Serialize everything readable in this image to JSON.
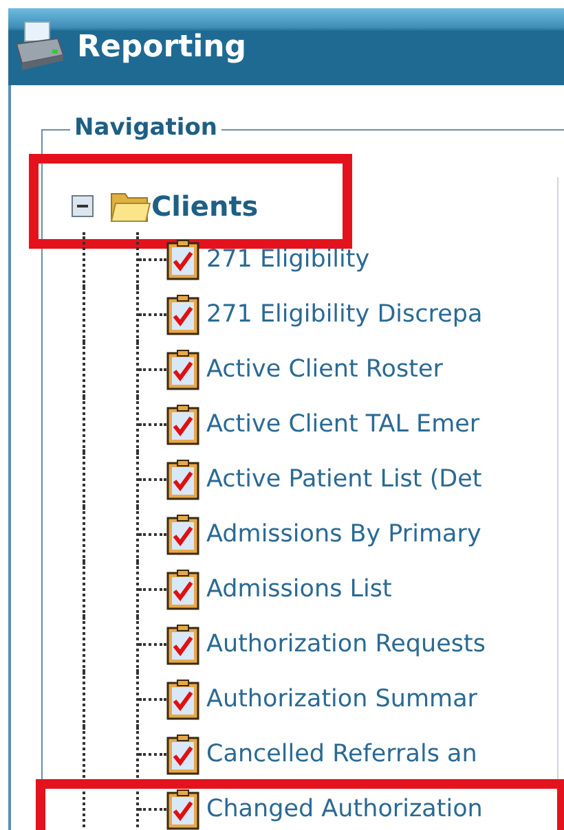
{
  "header": {
    "title": "Reporting"
  },
  "navigation": {
    "legend": "Navigation",
    "tree": {
      "label": "Clients",
      "expanded": true,
      "highlighted": true,
      "children": [
        {
          "label": "271 Eligibility",
          "highlighted": false
        },
        {
          "label": "271 Eligibility Discrepa",
          "highlighted": false
        },
        {
          "label": "Active Client Roster",
          "highlighted": false
        },
        {
          "label": "Active Client TAL Emer",
          "highlighted": false
        },
        {
          "label": "Active Patient List (Det",
          "highlighted": false
        },
        {
          "label": "Admissions By Primary",
          "highlighted": false
        },
        {
          "label": "Admissions List",
          "highlighted": false
        },
        {
          "label": "Authorization Requests",
          "highlighted": false
        },
        {
          "label": "Authorization Summar",
          "highlighted": false
        },
        {
          "label": "Cancelled Referrals an",
          "highlighted": false
        },
        {
          "label": "Changed Authorization",
          "highlighted": true
        }
      ]
    }
  }
}
